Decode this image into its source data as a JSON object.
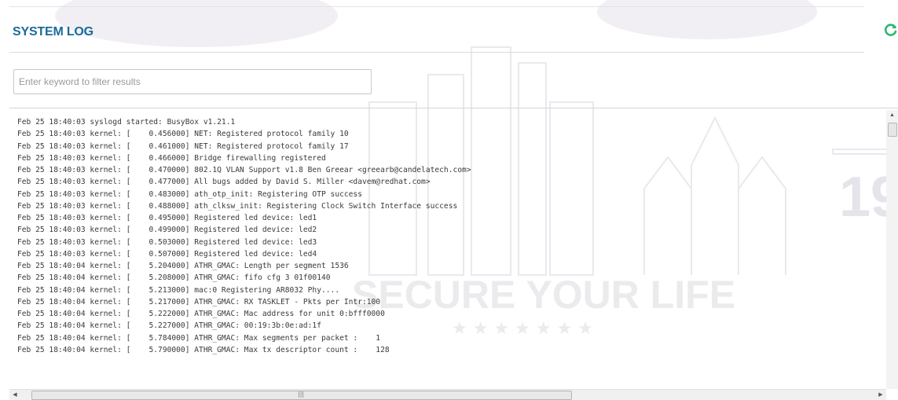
{
  "header": {
    "title": "SYSTEM LOG",
    "refresh_icon": "refresh-icon",
    "accent_color": "#1a6b9a",
    "refresh_color": "#2bb673"
  },
  "filter": {
    "placeholder": "Enter keyword to filter results",
    "value": ""
  },
  "watermark": {
    "tagline": "SECURE YOUR LIFE",
    "fragment": "19"
  },
  "log": {
    "lines": [
      "Feb 25 18:40:03 syslogd started: BusyBox v1.21.1",
      "Feb 25 18:40:03 kernel: [    0.456000] NET: Registered protocol family 10",
      "Feb 25 18:40:03 kernel: [    0.461000] NET: Registered protocol family 17",
      "Feb 25 18:40:03 kernel: [    0.466000] Bridge firewalling registered",
      "Feb 25 18:40:03 kernel: [    0.470000] 802.1Q VLAN Support v1.8 Ben Greear <greearb@candelatech.com>",
      "Feb 25 18:40:03 kernel: [    0.477000] All bugs added by David S. Miller <davem@redhat.com>",
      "Feb 25 18:40:03 kernel: [    0.483000] ath_otp_init: Registering OTP success",
      "Feb 25 18:40:03 kernel: [    0.488000] ath_clksw_init: Registering Clock Switch Interface success",
      "Feb 25 18:40:03 kernel: [    0.495000] Registered led device: led1",
      "Feb 25 18:40:03 kernel: [    0.499000] Registered led device: led2",
      "Feb 25 18:40:03 kernel: [    0.503000] Registered led device: led3",
      "Feb 25 18:40:03 kernel: [    0.507000] Registered led device: led4",
      "Feb 25 18:40:04 kernel: [    5.204000] ATHR_GMAC: Length per segment 1536",
      "Feb 25 18:40:04 kernel: [    5.208000] ATHR_GMAC: fifo cfg 3 01f00140",
      "Feb 25 18:40:04 kernel: [    5.213000] mac:0 Registering AR8032 Phy....",
      "Feb 25 18:40:04 kernel: [    5.217000] ATHR_GMAC: RX TASKLET - Pkts per Intr:100",
      "Feb 25 18:40:04 kernel: [    5.222000] ATHR_GMAC: Mac address for unit 0:bfff0000",
      "Feb 25 18:40:04 kernel: [    5.227000] ATHR_GMAC: 00:19:3b:0e:ad:1f",
      "Feb 25 18:40:04 kernel: [    5.784000] ATHR_GMAC: Max segments per packet :    1",
      "Feb 25 18:40:04 kernel: [    5.790000] ATHR_GMAC: Max tx descriptor count :    128"
    ]
  }
}
